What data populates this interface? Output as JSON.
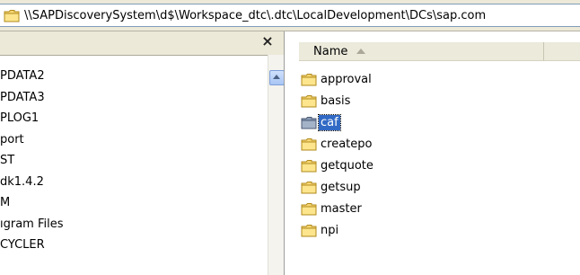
{
  "address": {
    "path": "\\\\SAPDiscoverySystem\\d$\\Workspace_dtc\\.dtc\\LocalDevelopment\\DCs\\sap.com"
  },
  "folders_pane": {
    "close_label": "×",
    "items": [
      "PDATA2",
      "PDATA3",
      "PLOG1",
      "port",
      "ST",
      "dk1.4.2",
      "M",
      "ıgram Files",
      "CYCLER"
    ]
  },
  "file_list": {
    "column_name": "Name",
    "selected": "caf",
    "items": [
      "approval",
      "basis",
      "caf",
      "createpo",
      "getquote",
      "getsup",
      "master",
      "npi"
    ]
  },
  "colors": {
    "selection": "#316ac5",
    "folder": "#f7d774",
    "window_bg": "#ece9d8"
  }
}
